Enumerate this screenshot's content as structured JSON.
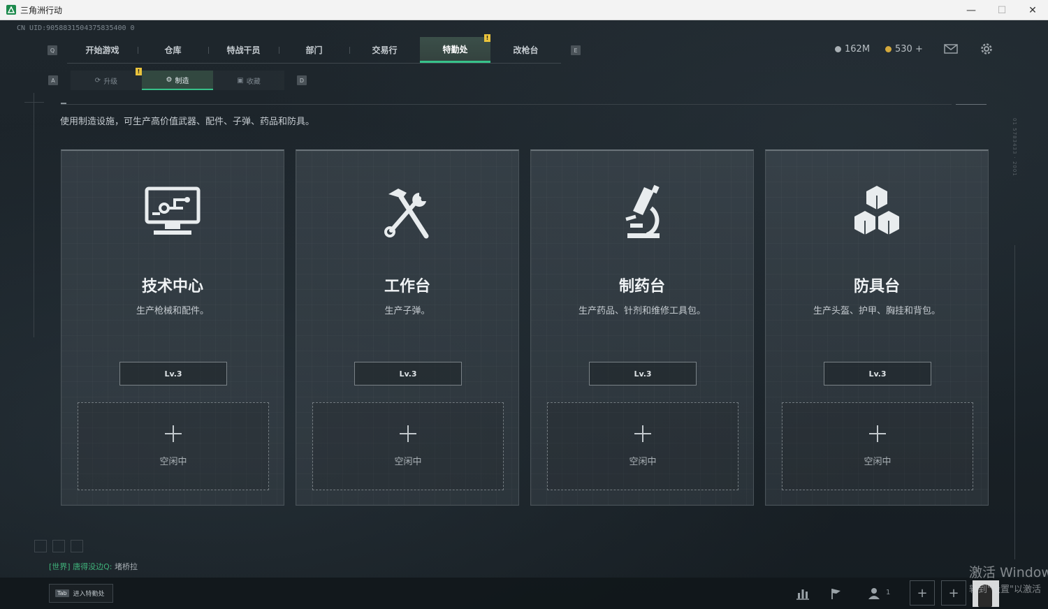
{
  "window": {
    "title": "三角洲行动",
    "controls": [
      "—",
      "☐",
      "✕"
    ]
  },
  "uid": "CN UID:9058831504375835400 0",
  "nav": {
    "left_key": "Q",
    "right_key": "E",
    "tabs": [
      "开始游戏",
      "仓库",
      "特战干员",
      "部门",
      "交易行",
      "特勤处",
      "改枪台"
    ],
    "active": "特勤处",
    "badge": "!"
  },
  "currency": {
    "silver": "162M",
    "gold": "530 +"
  },
  "subnav": {
    "left_key": "A",
    "right_key": "D",
    "tabs": [
      {
        "icon": "upgrade-icon",
        "label": "升级"
      },
      {
        "icon": "craft-icon",
        "label": "制造"
      },
      {
        "icon": "collect-icon",
        "label": "收藏"
      }
    ],
    "active": "制造",
    "badge": "!"
  },
  "description": "使用制造设施，可生产高价值武器、配件、子弹、药品和防具。",
  "cards": [
    {
      "icon": "computer-icon",
      "title": "技术中心",
      "subtitle": "生产枪械和配件。",
      "level": "Lv.3",
      "slot_label": "空闲中"
    },
    {
      "icon": "hammer-wrench-icon",
      "title": "工作台",
      "subtitle": "生产子弹。",
      "level": "Lv.3",
      "slot_label": "空闲中"
    },
    {
      "icon": "microscope-icon",
      "title": "制药台",
      "subtitle": "生产药品、针剂和维修工具包。",
      "level": "Lv.3",
      "slot_label": "空闲中"
    },
    {
      "icon": "boxes-icon",
      "title": "防具台",
      "subtitle": "生产头盔、护甲、胸挂和背包。",
      "level": "Lv.3",
      "slot_label": "空闲中"
    }
  ],
  "chat": {
    "channel": "[世界]",
    "user": "唐得没边Q:",
    "message": "堵桥拉"
  },
  "bottom": {
    "tab_key": "Tab",
    "tab_label": "进入特勤处",
    "player_count": "1"
  },
  "watermark": {
    "line1": "激活 Window",
    "line2": "转到\"设置\"以激活"
  },
  "colors": {
    "accent": "#37c28a",
    "badge": "#e9c33c"
  }
}
